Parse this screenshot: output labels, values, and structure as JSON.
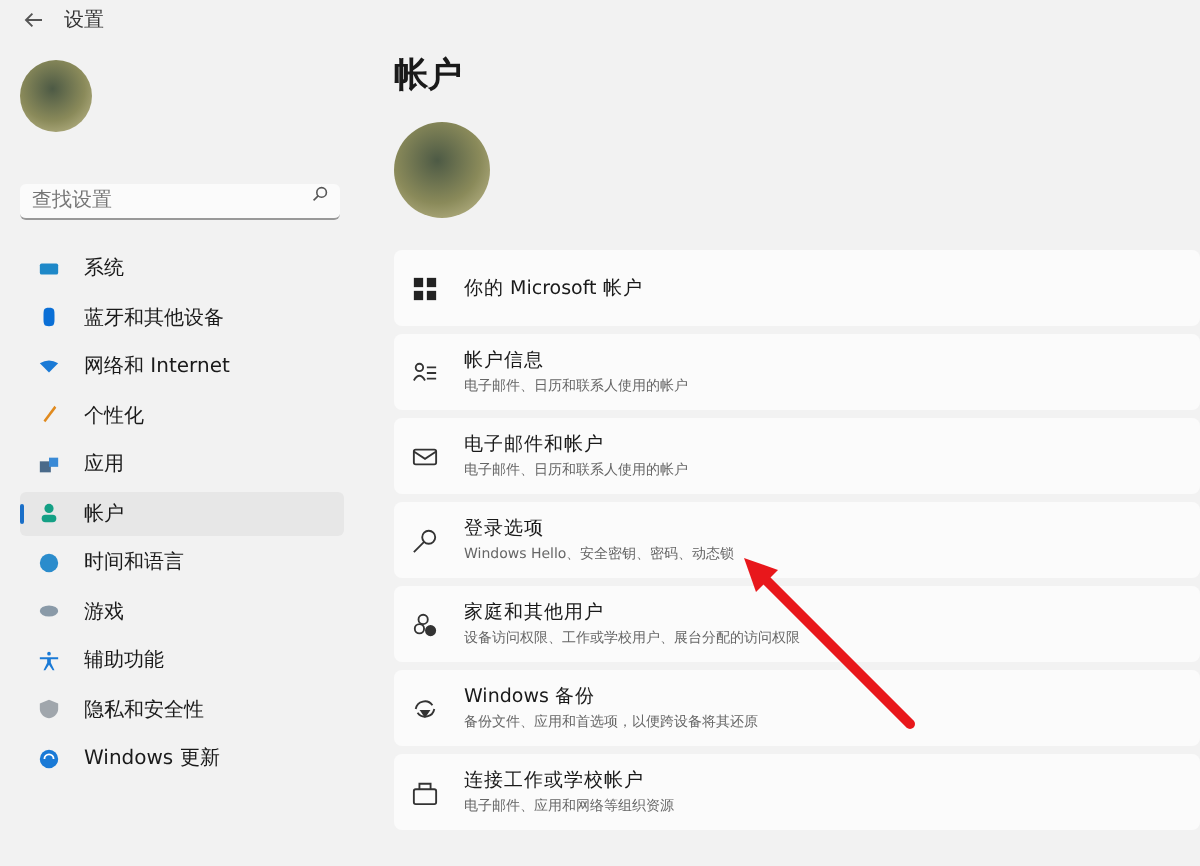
{
  "window": {
    "title": "设置"
  },
  "search": {
    "placeholder": "查找设置"
  },
  "sidebar": {
    "items": [
      {
        "label": "系统",
        "selected": false
      },
      {
        "label": "蓝牙和其他设备",
        "selected": false
      },
      {
        "label": "网络和 Internet",
        "selected": false
      },
      {
        "label": "个性化",
        "selected": false
      },
      {
        "label": "应用",
        "selected": false
      },
      {
        "label": "帐户",
        "selected": true
      },
      {
        "label": "时间和语言",
        "selected": false
      },
      {
        "label": "游戏",
        "selected": false
      },
      {
        "label": "辅助功能",
        "selected": false
      },
      {
        "label": "隐私和安全性",
        "selected": false
      },
      {
        "label": "Windows 更新",
        "selected": false
      }
    ]
  },
  "page": {
    "title": "帐户",
    "cards": [
      {
        "title": "你的 Microsoft 帐户"
      },
      {
        "title": "帐户信息",
        "subtitle": "电子邮件、日历和联系人使用的帐户"
      },
      {
        "title": "电子邮件和帐户",
        "subtitle": "电子邮件、日历和联系人使用的帐户"
      },
      {
        "title": "登录选项",
        "subtitle": "Windows Hello、安全密钥、密码、动态锁"
      },
      {
        "title": "家庭和其他用户",
        "subtitle": "设备访问权限、工作或学校用户、展台分配的访问权限"
      },
      {
        "title": "Windows 备份",
        "subtitle": "备份文件、应用和首选项，以便跨设备将其还原"
      },
      {
        "title": "连接工作或学校帐户",
        "subtitle": "电子邮件、应用和网络等组织资源"
      }
    ]
  }
}
